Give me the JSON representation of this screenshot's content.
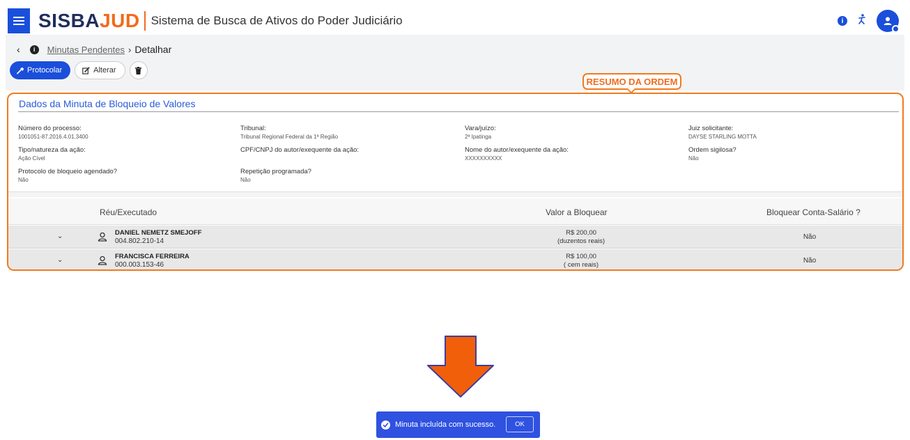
{
  "header": {
    "brand_part1": "SISBA",
    "brand_part2": "JUD",
    "subtitle": "Sistema de Busca de Ativos do Poder Judiciário"
  },
  "breadcrumb": {
    "back_glyph": "‹",
    "link": "Minutas Pendentes",
    "separator": "›",
    "current": "Detalhar"
  },
  "toolbar": {
    "protocolar_label": "Protocolar",
    "alterar_label": "Alterar"
  },
  "callout": {
    "text": "RESUMO DA ORDEM"
  },
  "card": {
    "title": "Dados da Minuta de Bloqueio de Valores",
    "fields": [
      {
        "label": "Número do processo:",
        "value": "1001051-87.2016.4.01.3400"
      },
      {
        "label": "Tribunal:",
        "value": "Tribunal Regional Federal da 1ª Região"
      },
      {
        "label": "Vara/juízo:",
        "value": "2ª Ipatinga"
      },
      {
        "label": "Juiz solicitante:",
        "value": "DAYSE STARLING MOTTA"
      },
      {
        "label": "Tipo/natureza da ação:",
        "value": "Ação Cível"
      },
      {
        "label": "CPF/CNPJ do autor/exequente da ação:",
        "value": ""
      },
      {
        "label": "Nome do autor/exequente da ação:",
        "value": "XXXXXXXXXX"
      },
      {
        "label": "Ordem sigilosa?",
        "value": "Não"
      },
      {
        "label": "Protocolo de bloqueio agendado?",
        "value": "Não"
      },
      {
        "label": "Repetição programada?",
        "value": "Não"
      }
    ]
  },
  "table": {
    "columns": [
      "Réu/Executado",
      "Valor a Bloquear",
      "Bloquear Conta-Salário ?"
    ],
    "rows": [
      {
        "name": "DANIEL NEMETZ SMEJOFF",
        "cpf": "004.802.210-14",
        "valor": "R$ 200,00",
        "valor_extenso": "(duzentos reais)",
        "conta_salario": "Não"
      },
      {
        "name": "FRANCISCA FERREIRA",
        "cpf": "000.003.153-46",
        "valor": "R$ 100,00",
        "valor_extenso": "( cem reais)",
        "conta_salario": "Não"
      }
    ]
  },
  "toast": {
    "message": "Minuta incluída com sucesso.",
    "ok_label": "OK"
  },
  "icons": {
    "menu": "hamburger-icon",
    "info": "info-icon",
    "accessibility": "accessibility-icon",
    "user": "user-avatar-icon"
  },
  "colors": {
    "primary": "#1a4fdb",
    "brand_accent": "#f26b1d",
    "highlight": "#f27a1d",
    "toast": "#2f52e0"
  }
}
